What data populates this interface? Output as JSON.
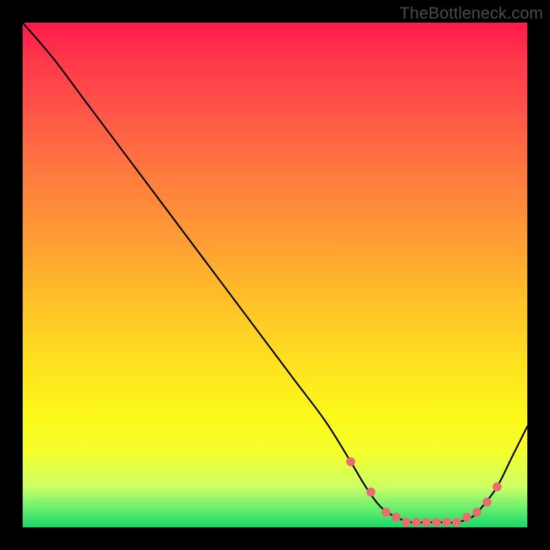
{
  "watermark": "TheBottleneck.com",
  "chart_data": {
    "type": "line",
    "title": "",
    "xlabel": "",
    "ylabel": "",
    "xlim": [
      0,
      100
    ],
    "ylim": [
      0,
      100
    ],
    "x": [
      0,
      6,
      12,
      18,
      24,
      30,
      36,
      42,
      48,
      54,
      60,
      65,
      68,
      71,
      74,
      77,
      80,
      83,
      86,
      89,
      91,
      94,
      97,
      100
    ],
    "values": [
      100,
      93,
      85,
      77,
      69,
      61,
      53,
      45,
      37,
      29,
      21,
      13,
      8,
      4,
      2,
      1,
      1,
      1,
      1,
      2,
      4,
      8,
      14,
      20
    ],
    "markers_x": [
      65,
      69,
      72,
      74,
      76,
      78,
      80,
      82,
      84,
      86,
      88,
      90,
      92,
      94
    ],
    "markers_y": [
      13,
      7,
      3,
      2,
      1,
      1,
      1,
      1,
      1,
      1,
      2,
      3,
      5,
      8
    ],
    "marker_color": "#e86d6d",
    "line_color": "#000000"
  }
}
